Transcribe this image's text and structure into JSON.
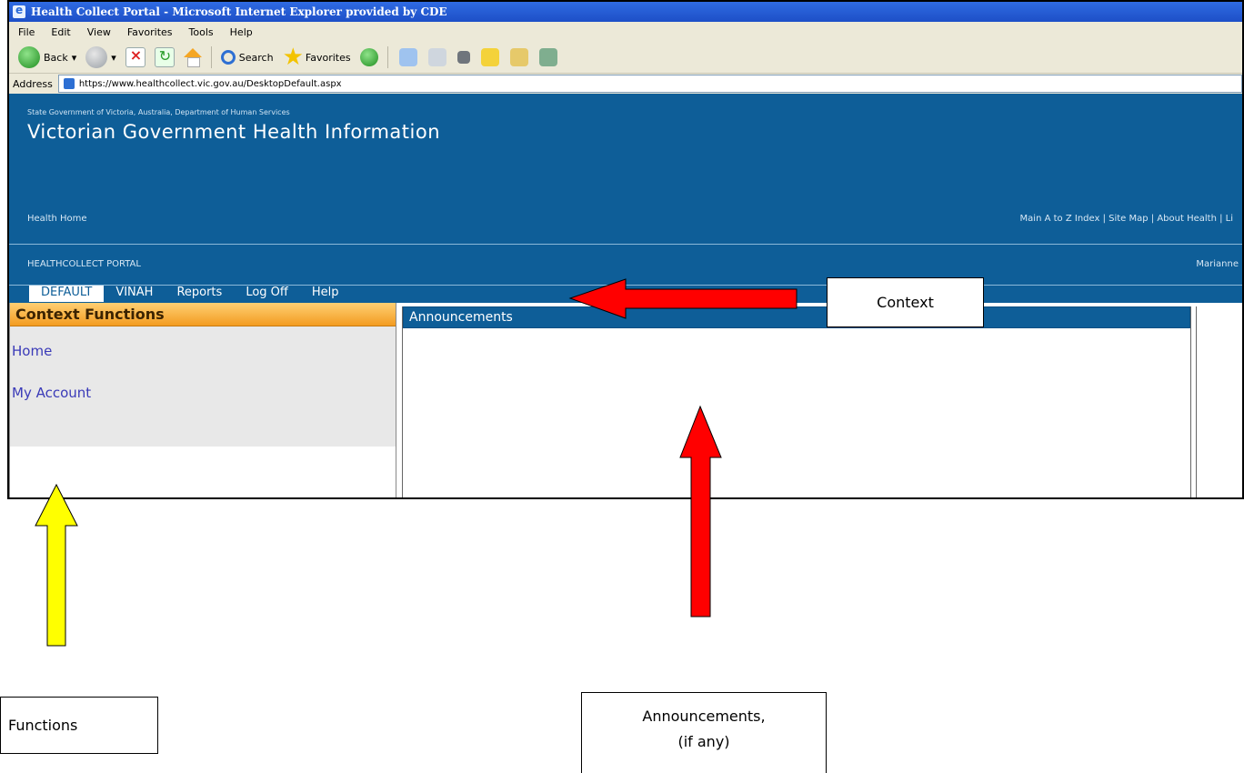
{
  "browser": {
    "title": "Health Collect Portal - Microsoft Internet Explorer provided by CDE",
    "menu": [
      "File",
      "Edit",
      "View",
      "Favorites",
      "Tools",
      "Help"
    ],
    "toolbar": {
      "back": "Back",
      "search": "Search",
      "favorites": "Favorites"
    },
    "address_label": "Address",
    "address": "https://www.healthcollect.vic.gov.au/DesktopDefault.aspx"
  },
  "site": {
    "agency": "State Government of Victoria, Australia, Department of Human Services",
    "title": "Victorian Government Health Information",
    "home_link": "Health Home",
    "links": "Main A to Z Index | Site Map | About Health | Li",
    "portal": "HEALTHCOLLECT PORTAL",
    "user": "Marianne",
    "tabs": [
      "DEFAULT",
      "VINAH",
      "Reports",
      "Log Off",
      "Help"
    ],
    "left_heading": "Context Functions",
    "left_links": [
      "Home",
      "My Account"
    ],
    "center_heading": "Announcements"
  },
  "annotations": {
    "context": "Context",
    "functions": "Functions",
    "announcements_line1": "Announcements,",
    "announcements_line2": "(if any)",
    "colors": {
      "red_arrow": "#ff0000",
      "yellow_arrow": "#ffff00"
    }
  }
}
